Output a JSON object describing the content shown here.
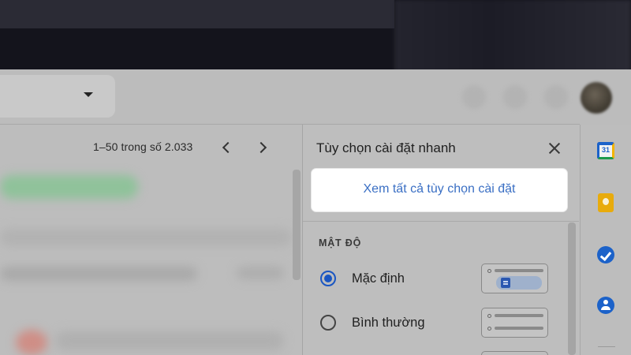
{
  "mail_list": {
    "pagination": "1–50 trong số 2.033"
  },
  "quick_settings": {
    "title": "Tùy chọn cài đặt nhanh",
    "see_all_settings": "Xem tất cả tùy chọn cài đặt",
    "density": {
      "heading": "MẬT ĐỘ",
      "options": [
        {
          "label": "Mặc định",
          "selected": true
        },
        {
          "label": "Bình thường",
          "selected": false
        }
      ]
    }
  },
  "side_apps": {
    "calendar_day": "31",
    "icons": [
      "calendar-icon",
      "keep-icon",
      "tasks-icon",
      "contacts-icon"
    ]
  },
  "colors": {
    "accent_blue": "#1a56c2",
    "link_blue": "#3a6fc4"
  }
}
